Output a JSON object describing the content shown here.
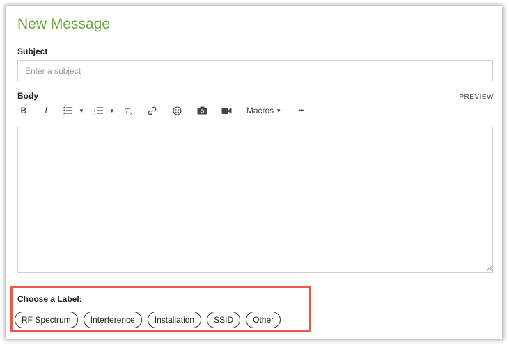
{
  "form": {
    "title": "New Message",
    "subject_label": "Subject",
    "subject_placeholder": "Enter a subject",
    "subject_value": "",
    "body_label": "Body",
    "preview_label": "PREVIEW",
    "body_value": ""
  },
  "toolbar": {
    "bold_label": "B",
    "italic_label": "I",
    "macros_label": "Macros",
    "more_label": "•••",
    "icons": [
      "bold-icon",
      "italic-icon",
      "bulleted-list-icon",
      "numbered-list-icon",
      "clear-format-icon",
      "link-icon",
      "emoji-icon",
      "camera-icon",
      "video-icon",
      "macros-dropdown",
      "more-icon"
    ]
  },
  "labels": {
    "title": "Choose a Label:",
    "options": [
      "RF Spectrum",
      "Interference",
      "Installation",
      "SSID",
      "Other"
    ]
  },
  "colors": {
    "title_green": "#6aaa3c",
    "highlight_red": "#e8584d"
  }
}
